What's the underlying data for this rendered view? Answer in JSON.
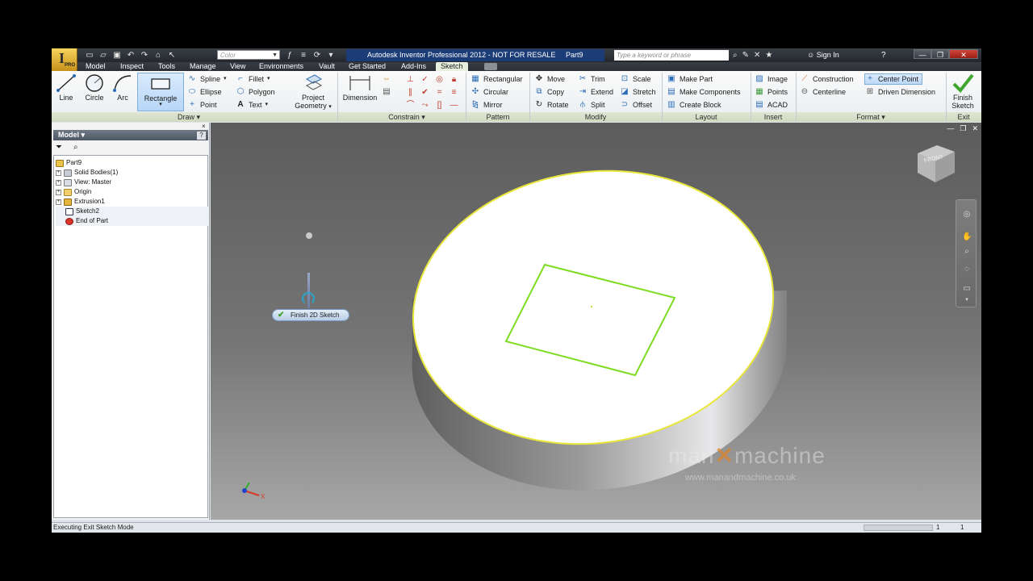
{
  "title_bar": {
    "app_title": "Autodesk Inventor Professional 2012 - NOT FOR RESALE",
    "document": "Part9",
    "logo_letter": "I",
    "logo_badge": "PRO",
    "color_combo": "Color",
    "search_placeholder": "Type a keyword or phrase",
    "sign_in": "Sign In",
    "help": "?"
  },
  "menu_tabs": [
    "Model",
    "Inspect",
    "Tools",
    "Manage",
    "View",
    "Environments",
    "Vault",
    "Get Started",
    "Add-Ins",
    "Sketch"
  ],
  "active_tab": "Sketch",
  "ribbon": {
    "draw": {
      "label": "Draw",
      "line": "Line",
      "circle": "Circle",
      "arc": "Arc",
      "rectangle": "Rectangle",
      "spline": "Spline",
      "ellipse": "Ellipse",
      "point": "Point",
      "fillet": "Fillet",
      "polygon": "Polygon",
      "text": "Text"
    },
    "project_geometry": [
      "Project",
      "Geometry"
    ],
    "constrain": {
      "label": "Constrain",
      "dimension": "Dimension"
    },
    "pattern": {
      "label": "Pattern",
      "rectangular": "Rectangular",
      "circular": "Circular",
      "mirror": "Mirror"
    },
    "modify": {
      "label": "Modify",
      "move": "Move",
      "copy": "Copy",
      "rotate": "Rotate",
      "trim": "Trim",
      "extend": "Extend",
      "split": "Split",
      "scale": "Scale",
      "stretch": "Stretch",
      "offset": "Offset"
    },
    "layout": {
      "label": "Layout",
      "make_part": "Make Part",
      "make_components": "Make Components",
      "create_block": "Create Block"
    },
    "insert": {
      "label": "Insert",
      "image": "Image",
      "points": "Points",
      "acad": "ACAD"
    },
    "format": {
      "label": "Format",
      "construction": "Construction",
      "centerline": "Centerline",
      "center_point": "Center Point",
      "driven_dimension": "Driven Dimension"
    },
    "exit": {
      "label": "Exit",
      "finish_sketch": [
        "Finish",
        "Sketch"
      ]
    }
  },
  "browser": {
    "header": "Model",
    "help": "?",
    "close": "×",
    "tree": [
      {
        "label": "Part9",
        "icon": "part-icon",
        "indent": 0
      },
      {
        "label": "Solid Bodies(1)",
        "icon": "solid-bodies-icon",
        "indent": 1
      },
      {
        "label": "View: Master",
        "icon": "view-icon",
        "indent": 1
      },
      {
        "label": "Origin",
        "icon": "folder-icon",
        "indent": 1
      },
      {
        "label": "Extrusion1",
        "icon": "extrusion-icon",
        "indent": 1
      },
      {
        "label": "Sketch2",
        "icon": "sketch-icon",
        "indent": 1
      },
      {
        "label": "End of Part",
        "icon": "end-of-part-icon",
        "indent": 1
      }
    ]
  },
  "graphics": {
    "finish_2d_sketch": "Finish 2D Sketch",
    "viewcube_face": "FRONT",
    "watermark_left": "man",
    "watermark_right": "machine",
    "watermark_url": "www.manandmachine.co.uk",
    "triad_x_label": "X"
  },
  "status_bar": {
    "message": "Executing Exit Sketch Mode",
    "value_1": "1",
    "value_2": "1"
  },
  "colors": {
    "sketch_green": "#7ddc1f",
    "face_edge_yellow": "#e8e63a",
    "title_blue": "#1c3c78"
  }
}
